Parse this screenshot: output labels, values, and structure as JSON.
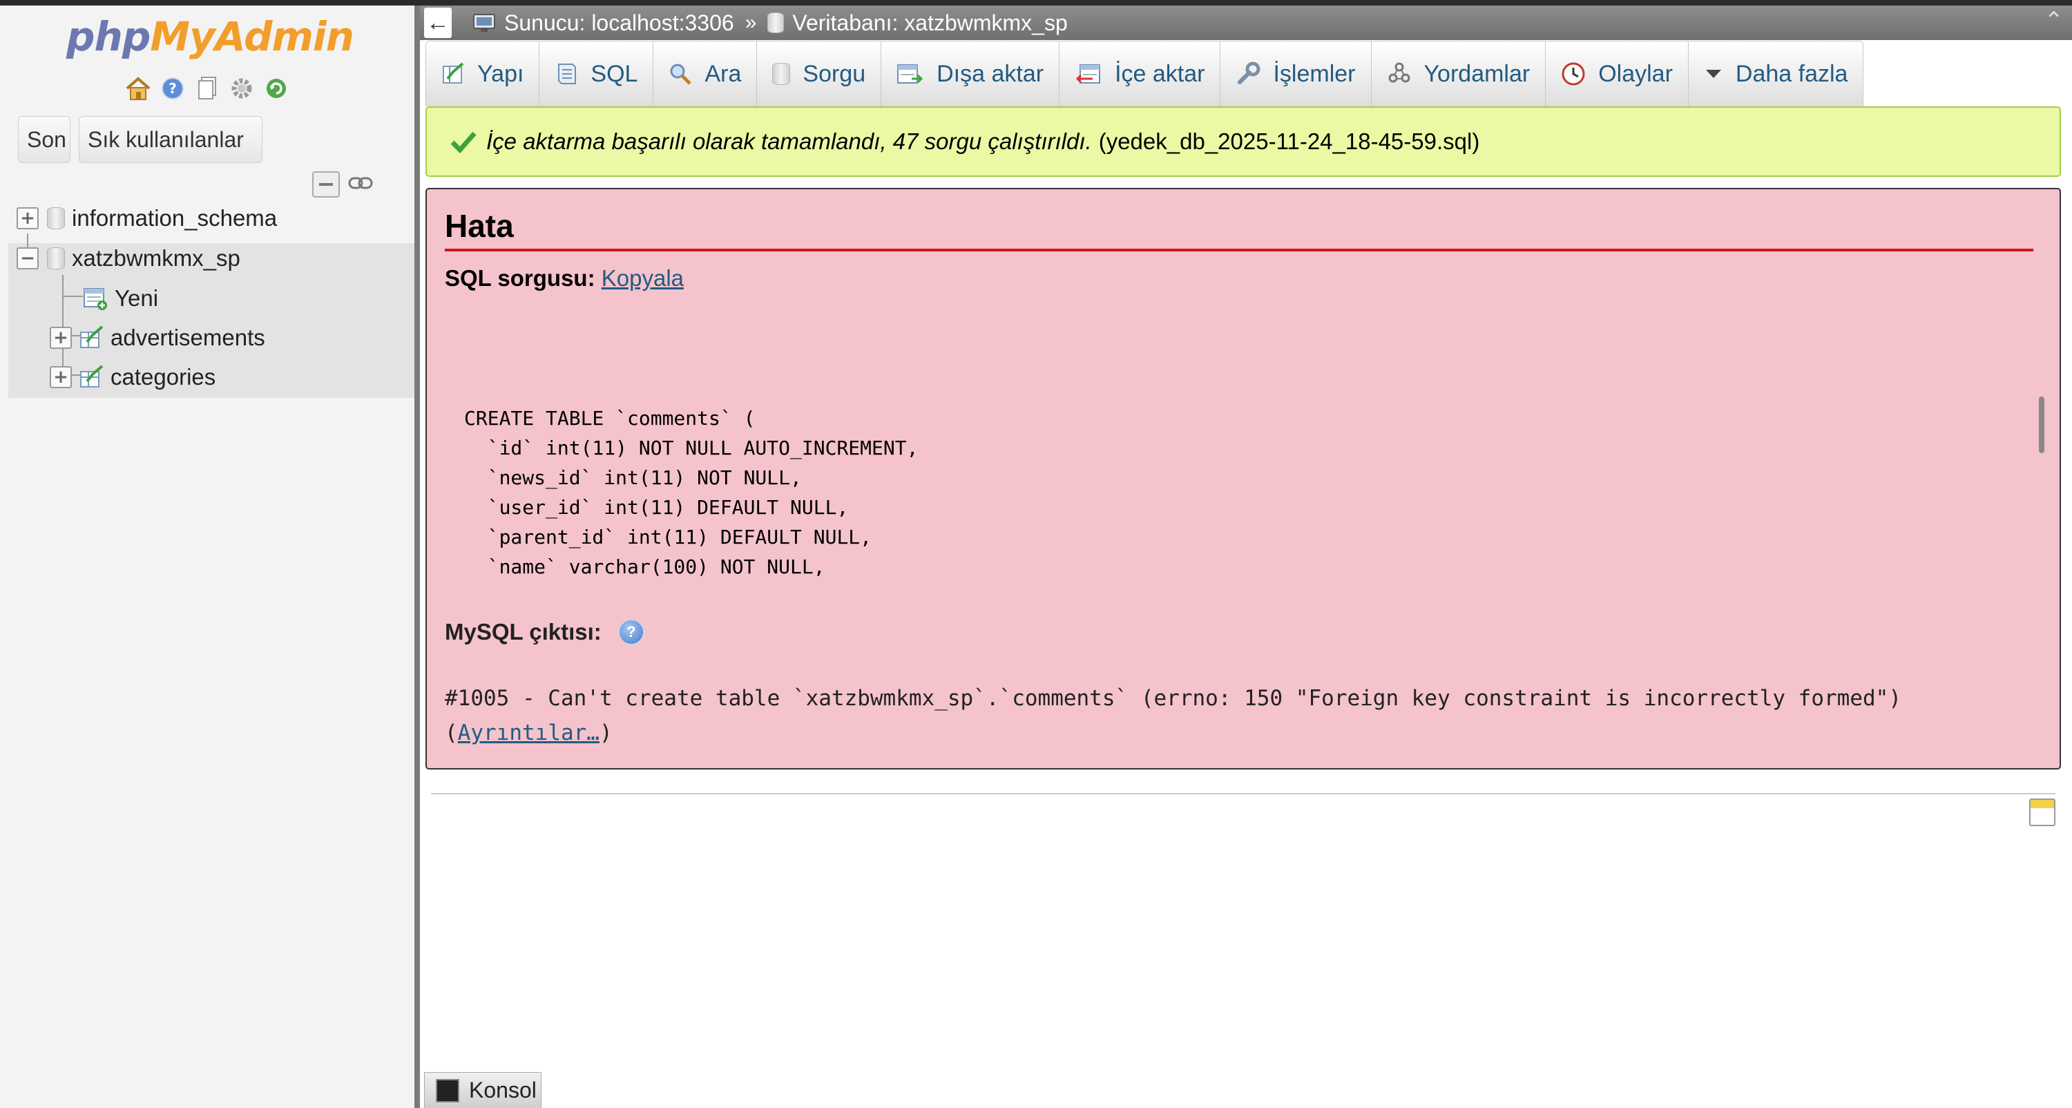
{
  "logo": {
    "part1": "php",
    "part2": "MyAdmin"
  },
  "sidebar": {
    "buttons": {
      "recent": "Son",
      "favorites": "Sık kullanılanlar"
    },
    "tree": {
      "databases": [
        {
          "name": "information_schema",
          "expanded": false
        },
        {
          "name": "xatzbwmkmx_sp",
          "expanded": true
        }
      ],
      "children": [
        {
          "label": "Yeni",
          "icon": "new-table-icon"
        },
        {
          "label": "advertisements",
          "icon": "table-icon"
        },
        {
          "label": "categories",
          "icon": "table-icon"
        }
      ]
    }
  },
  "breadcrumb": {
    "server": "Sunucu: localhost:3306",
    "separator": "»",
    "database": "Veritabanı: xatzbwmkmx_sp"
  },
  "tabs": [
    {
      "label": "Yapı",
      "icon": "structure-icon"
    },
    {
      "label": "SQL",
      "icon": "sql-icon"
    },
    {
      "label": "Ara",
      "icon": "search-icon"
    },
    {
      "label": "Sorgu",
      "icon": "query-icon"
    },
    {
      "label": "Dışa aktar",
      "icon": "export-icon"
    },
    {
      "label": "İçe aktar",
      "icon": "import-icon"
    },
    {
      "label": "İşlemler",
      "icon": "wrench-icon"
    },
    {
      "label": "Yordamlar",
      "icon": "routines-icon"
    },
    {
      "label": "Olaylar",
      "icon": "events-icon"
    },
    {
      "label": "Daha fazla",
      "icon": "caret-down-icon"
    }
  ],
  "success": {
    "message": "İçe aktarma başarılı olarak tamamlandı, 47 sorgu çalıştırıldı.",
    "file": "(yedek_db_2025-11-24_18-45-59.sql)"
  },
  "error": {
    "title": "Hata",
    "sql_label": "SQL sorgusu:",
    "copy_link": "Kopyala",
    "code": "CREATE TABLE `comments` (\n  `id` int(11) NOT NULL AUTO_INCREMENT,\n  `news_id` int(11) NOT NULL,\n  `user_id` int(11) DEFAULT NULL,\n  `parent_id` int(11) DEFAULT NULL,\n  `name` varchar(100) NOT NULL,",
    "output_label": "MySQL çıktısı:",
    "message": "#1005 - Can't create table `xatzbwmkmx_sp`.`comments` (errno: 150 \"Foreign key constraint is incorrectly formed\")",
    "details_open": "(",
    "details_link": "Ayrıntılar…",
    "details_close": ")"
  },
  "console": {
    "label": "Konsol"
  },
  "colors": {
    "link": "#235a81",
    "success_bg": "#ebf8a4",
    "error_bg": "#f4c3cb",
    "error_rule": "#d31717"
  }
}
